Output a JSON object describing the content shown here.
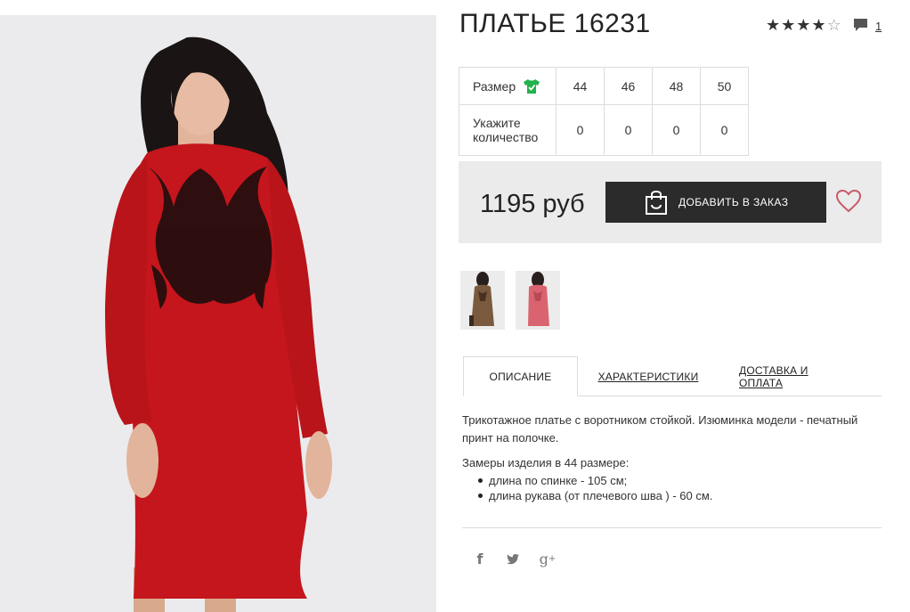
{
  "product": {
    "title": "ПЛАТЬЕ 16231",
    "rating": 4,
    "rating_max": 5,
    "comments_count": "1"
  },
  "sizes_table": {
    "size_label": "Размер",
    "qty_label": "Укажите количество",
    "sizes": [
      "44",
      "46",
      "48",
      "50"
    ],
    "quantities": [
      "0",
      "0",
      "0",
      "0"
    ]
  },
  "purchase": {
    "price": "1195 руб",
    "add_button_label": "ДОБАВИТЬ В ЗАКАЗ"
  },
  "tabs": [
    {
      "label": "ОПИСАНИЕ",
      "active": true
    },
    {
      "label": "ХАРАКТЕРИСТИКИ",
      "active": false
    },
    {
      "label": "ДОСТАВКА И ОПЛАТА",
      "active": false
    }
  ],
  "description": {
    "text": "Трикотажное платье с воротником стойкой. Изюминка модели - печатный принт на полочке.",
    "measure_title": "Замеры изделия в 44 размере:",
    "measures": [
      "длина по спинке - 105 см;",
      "длина рукава (от плечевого шва ) - 60 см."
    ]
  },
  "colors": {
    "dress_main": "#c4161c",
    "button_bg": "#2b2b2b",
    "price_box_bg": "#ebebeb",
    "shirt_icon": "#22b14c",
    "heart": "#c75b6a",
    "thumb1_dress": "#7a5a3e",
    "thumb2_dress": "#d9646f"
  },
  "icons": {
    "star": "star-icon",
    "comment": "speech-bubble-icon",
    "size_check": "shirt-check-icon",
    "bag": "shopping-bag-icon",
    "favorite": "heart-icon",
    "facebook": "facebook-icon",
    "twitter": "twitter-icon",
    "google_plus": "google-plus-icon"
  }
}
